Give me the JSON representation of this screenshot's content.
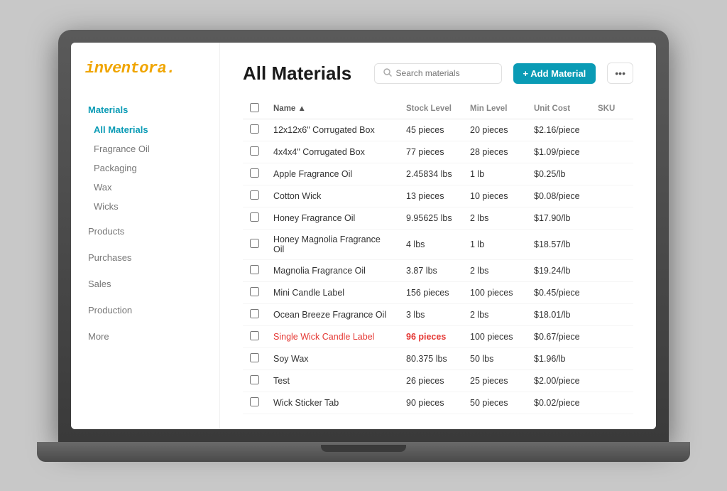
{
  "app": {
    "logo_text": "inventora",
    "logo_dot": "."
  },
  "sidebar": {
    "materials_label": "Materials",
    "all_materials_label": "All Materials",
    "sub_items": [
      {
        "label": "Fragrance Oil"
      },
      {
        "label": "Packaging"
      },
      {
        "label": "Wax"
      },
      {
        "label": "Wicks"
      }
    ],
    "top_nav": [
      {
        "label": "Products"
      },
      {
        "label": "Purchases"
      },
      {
        "label": "Sales"
      },
      {
        "label": "Production"
      },
      {
        "label": "More"
      }
    ]
  },
  "main": {
    "title": "All Materials",
    "search_placeholder": "Search materials",
    "add_button_label": "+ Add Material",
    "more_button_label": "•••"
  },
  "table": {
    "columns": [
      "",
      "Name ▲",
      "Stock Level",
      "Min Level",
      "Unit Cost",
      "SKU"
    ],
    "rows": [
      {
        "name": "12x12x6\" Corrugated Box",
        "stock": "45 pieces",
        "min": "20 pieces",
        "cost": "$2.16/piece",
        "sku": "",
        "low": false
      },
      {
        "name": "4x4x4\" Corrugated Box",
        "stock": "77 pieces",
        "min": "28 pieces",
        "cost": "$1.09/piece",
        "sku": "",
        "low": false
      },
      {
        "name": "Apple Fragrance Oil",
        "stock": "2.45834 lbs",
        "min": "1 lb",
        "cost": "$0.25/lb",
        "sku": "",
        "low": false
      },
      {
        "name": "Cotton Wick",
        "stock": "13 pieces",
        "min": "10 pieces",
        "cost": "$0.08/piece",
        "sku": "",
        "low": false
      },
      {
        "name": "Honey Fragrance Oil",
        "stock": "9.95625 lbs",
        "min": "2 lbs",
        "cost": "$17.90/lb",
        "sku": "",
        "low": false
      },
      {
        "name": "Honey Magnolia Fragrance Oil",
        "stock": "4 lbs",
        "min": "1 lb",
        "cost": "$18.57/lb",
        "sku": "",
        "low": false
      },
      {
        "name": "Magnolia Fragrance Oil",
        "stock": "3.87 lbs",
        "min": "2 lbs",
        "cost": "$19.24/lb",
        "sku": "",
        "low": false
      },
      {
        "name": "Mini Candle Label",
        "stock": "156 pieces",
        "min": "100 pieces",
        "cost": "$0.45/piece",
        "sku": "",
        "low": false
      },
      {
        "name": "Ocean Breeze Fragrance Oil",
        "stock": "3 lbs",
        "min": "2 lbs",
        "cost": "$18.01/lb",
        "sku": "",
        "low": false
      },
      {
        "name": "Single Wick Candle Label",
        "stock": "96 pieces",
        "min": "100 pieces",
        "cost": "$0.67/piece",
        "sku": "",
        "low": true
      },
      {
        "name": "Soy Wax",
        "stock": "80.375 lbs",
        "min": "50 lbs",
        "cost": "$1.96/lb",
        "sku": "",
        "low": false
      },
      {
        "name": "Test",
        "stock": "26 pieces",
        "min": "25 pieces",
        "cost": "$2.00/piece",
        "sku": "",
        "low": false
      },
      {
        "name": "Wick Sticker Tab",
        "stock": "90 pieces",
        "min": "50 pieces",
        "cost": "$0.02/piece",
        "sku": "",
        "low": false
      }
    ]
  }
}
